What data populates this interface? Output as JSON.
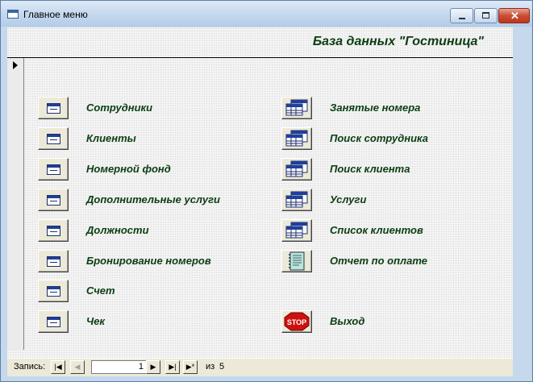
{
  "window": {
    "title": "Главное меню"
  },
  "header": {
    "db_title": "База данных \"Гостиница\""
  },
  "menu_left": [
    {
      "label": "Сотрудники",
      "icon": "form-icon"
    },
    {
      "label": "Клиенты",
      "icon": "form-icon"
    },
    {
      "label": "Номерной фонд",
      "icon": "form-icon"
    },
    {
      "label": "Дополнительные услуги",
      "icon": "form-icon"
    },
    {
      "label": "Должности",
      "icon": "form-icon"
    },
    {
      "label": "Бронирование номеров",
      "icon": "form-icon"
    },
    {
      "label": "Счет",
      "icon": "form-icon"
    },
    {
      "label": "Чек",
      "icon": "form-icon"
    }
  ],
  "menu_right": [
    {
      "label": "Занятые номера",
      "icon": "table-icon"
    },
    {
      "label": "Поиск сотрудника",
      "icon": "table-icon"
    },
    {
      "label": "Поиск клиента",
      "icon": "table-icon"
    },
    {
      "label": "Услуги",
      "icon": "table-icon"
    },
    {
      "label": "Список клиентов",
      "icon": "table-icon"
    },
    {
      "label": "Отчет по оплате",
      "icon": "report-icon"
    },
    {
      "label": "Выход",
      "icon": "stop-icon",
      "icon_text": "STOP"
    }
  ],
  "navigation": {
    "label": "Запись:",
    "current": "1",
    "of_label": "из",
    "total": "5"
  },
  "colors": {
    "label_text": "#0b3d12",
    "stop_red": "#cc1111",
    "form_blue": "#1f3f9a"
  }
}
